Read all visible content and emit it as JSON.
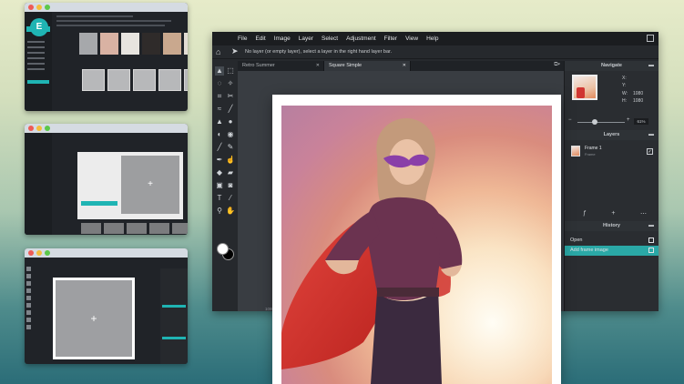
{
  "thumb1": {
    "logo_letter": "E"
  },
  "thumb2": {
    "plus": "+"
  },
  "thumb3": {
    "plus": "+"
  },
  "menu": [
    "File",
    "Edit",
    "Image",
    "Layer",
    "Select",
    "Adjustment",
    "Filter",
    "View",
    "Help"
  ],
  "options_hint": "No layer (or empty layer), select a layer in the right hand layer bar.",
  "tabs": [
    {
      "label": "Retro Summer",
      "active": false
    },
    {
      "label": "Square Simple",
      "active": true
    }
  ],
  "status": "1080 x 1080 px",
  "panels": {
    "navigate": {
      "title": "Navigate",
      "x_label": "X:",
      "y_label": "Y:",
      "w_label": "W:",
      "w_value": "1080",
      "h_label": "H:",
      "h_value": "1080",
      "zoom": "61%"
    },
    "layers": {
      "title": "Layers",
      "items": [
        {
          "name": "Frame 1",
          "sub": "Frame"
        }
      ]
    },
    "history": {
      "title": "History",
      "items": [
        {
          "label": "Open",
          "selected": false
        },
        {
          "label": "Add frame image",
          "selected": true
        }
      ]
    }
  },
  "colors": {
    "accent": "#2aa8a6",
    "cape": "#d8342e",
    "mask": "#8a3fa8"
  },
  "icons": [
    "home-icon",
    "move-arrow-icon",
    "marquee-icon",
    "lasso-icon",
    "crop-icon",
    "brush-icon",
    "eraser-icon",
    "text-icon",
    "zoom-icon",
    "hand-icon"
  ]
}
